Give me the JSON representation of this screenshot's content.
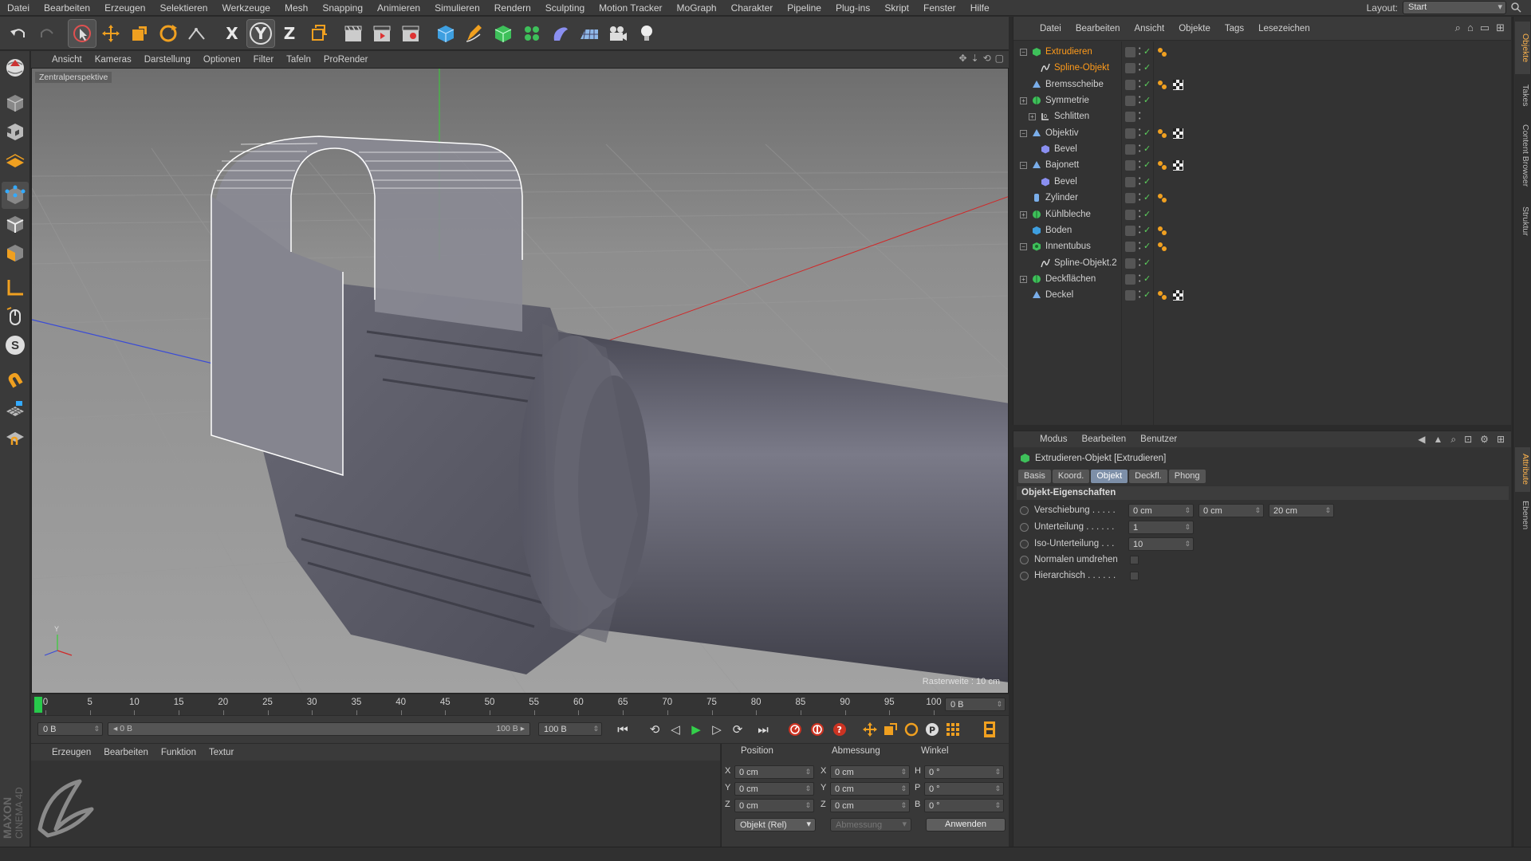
{
  "menubar": {
    "items": [
      "Datei",
      "Bearbeiten",
      "Erzeugen",
      "Selektieren",
      "Werkzeuge",
      "Mesh",
      "Snapping",
      "Animieren",
      "Simulieren",
      "Rendern",
      "Sculpting",
      "Motion Tracker",
      "MoGraph",
      "Charakter",
      "Pipeline",
      "Plug-ins",
      "Skript",
      "Fenster",
      "Hilfe"
    ],
    "layout_label": "Layout:",
    "layout_value": "Start"
  },
  "toolbar": {
    "axis_x": "X",
    "axis_y": "Y",
    "axis_z": "Z"
  },
  "left_palette": {
    "snap_letter": "S"
  },
  "viewport": {
    "menu": [
      "Ansicht",
      "Kameras",
      "Darstellung",
      "Optionen",
      "Filter",
      "Tafeln",
      "ProRender"
    ],
    "label": "Zentralperspektive",
    "raster": "Rasterweite : 10 cm"
  },
  "timeline": {
    "ticks": [
      "0",
      "5",
      "10",
      "15",
      "20",
      "25",
      "30",
      "35",
      "40",
      "45",
      "50",
      "55",
      "60",
      "65",
      "70",
      "75",
      "80",
      "85",
      "90",
      "95",
      "100"
    ],
    "current_frame_field": "0 B",
    "start_field": "0 B",
    "range_start": "0 B",
    "range_end": "100 B",
    "end_field": "100 B"
  },
  "materials": {
    "menu": [
      "Erzeugen",
      "Bearbeiten",
      "Funktion",
      "Textur"
    ]
  },
  "brand": {
    "line1": "MAXON",
    "line2": "CINEMA 4D"
  },
  "coords": {
    "headers": {
      "position": "Position",
      "size": "Abmessung",
      "rotation": "Winkel"
    },
    "rows": [
      {
        "axis": "X",
        "pos": "0 cm",
        "size_axis": "X",
        "size": "0 cm",
        "rot_axis": "H",
        "rot": "0 °"
      },
      {
        "axis": "Y",
        "pos": "0 cm",
        "size_axis": "Y",
        "size": "0 cm",
        "rot_axis": "P",
        "rot": "0 °"
      },
      {
        "axis": "Z",
        "pos": "0 cm",
        "size_axis": "Z",
        "size": "0 cm",
        "rot_axis": "B",
        "rot": "0 °"
      }
    ],
    "mode_dropdown": "Objekt (Rel)",
    "size_dropdown": "Abmessung",
    "apply": "Anwenden"
  },
  "object_manager": {
    "menu": [
      "Datei",
      "Bearbeiten",
      "Ansicht",
      "Objekte",
      "Tags",
      "Lesezeichen"
    ],
    "objects": [
      {
        "name": "Extrudieren",
        "depth": 0,
        "expand": "−",
        "icon": "extrude-icon",
        "selected": true,
        "tags": [
          "phong"
        ]
      },
      {
        "name": "Spline-Objekt",
        "depth": 1,
        "expand": "",
        "icon": "spline-icon",
        "selected": true,
        "tags": []
      },
      {
        "name": "Bremsscheibe",
        "depth": 0,
        "expand": "",
        "icon": "polygon-icon",
        "selected": false,
        "tags": [
          "phong",
          "checker"
        ]
      },
      {
        "name": "Symmetrie",
        "depth": 0,
        "expand": "+",
        "icon": "symmetry-icon",
        "selected": false,
        "tags": []
      },
      {
        "name": "Schlitten",
        "depth": 1,
        "expand": "+",
        "icon": "null-icon",
        "selected": false,
        "tags": []
      },
      {
        "name": "Objektiv",
        "depth": 0,
        "expand": "−",
        "icon": "polygon-icon",
        "selected": false,
        "tags": [
          "phong",
          "checker"
        ]
      },
      {
        "name": "Bevel",
        "depth": 1,
        "expand": "",
        "icon": "bevel-icon",
        "selected": false,
        "tags": []
      },
      {
        "name": "Bajonett",
        "depth": 0,
        "expand": "−",
        "icon": "polygon-icon",
        "selected": false,
        "tags": [
          "phong",
          "checker"
        ]
      },
      {
        "name": "Bevel",
        "depth": 1,
        "expand": "",
        "icon": "bevel-icon",
        "selected": false,
        "tags": []
      },
      {
        "name": "Zylinder",
        "depth": 0,
        "expand": "",
        "icon": "cylinder-icon",
        "selected": false,
        "tags": [
          "phong"
        ]
      },
      {
        "name": "Kühlbleche",
        "depth": 0,
        "expand": "+",
        "icon": "symmetry-icon",
        "selected": false,
        "tags": []
      },
      {
        "name": "Boden",
        "depth": 0,
        "expand": "",
        "icon": "cube-icon",
        "selected": false,
        "tags": [
          "phong"
        ]
      },
      {
        "name": "Innentubus",
        "depth": 0,
        "expand": "−",
        "icon": "lathe-icon",
        "selected": false,
        "tags": [
          "phong"
        ]
      },
      {
        "name": "Spline-Objekt.2",
        "depth": 1,
        "expand": "",
        "icon": "spline-icon",
        "selected": false,
        "tags": []
      },
      {
        "name": "Deckflächen",
        "depth": 0,
        "expand": "+",
        "icon": "symmetry-icon",
        "selected": false,
        "tags": []
      },
      {
        "name": "Deckel",
        "depth": 0,
        "expand": "",
        "icon": "polygon-icon",
        "selected": false,
        "tags": [
          "phong",
          "checker"
        ]
      }
    ]
  },
  "attribute_manager": {
    "menu": [
      "Modus",
      "Bearbeiten",
      "Benutzer"
    ],
    "title": "Extrudieren-Objekt [Extrudieren]",
    "tabs": [
      "Basis",
      "Koord.",
      "Objekt",
      "Deckfl.",
      "Phong"
    ],
    "active_tab": "Objekt",
    "section": "Objekt-Eigenschaften",
    "fields": {
      "offset_label": "Verschiebung . . . . .",
      "offset_x": "0 cm",
      "offset_y": "0 cm",
      "offset_z": "20 cm",
      "subdiv_label": "Unterteilung . . . . . .",
      "subdiv_value": "1",
      "iso_label": "Iso-Unterteilung . . .",
      "iso_value": "10",
      "flip_label": "Normalen umdrehen",
      "hier_label": "Hierarchisch . . . . . ."
    }
  },
  "right_tabs": [
    "Objekte",
    "Takes",
    "Content Browser",
    "Struktur",
    "Attribute",
    "Ebenen"
  ],
  "colors": {
    "accent": "#ff9b1a",
    "active_tab": "#7d8fa8",
    "frame_marker": "#27c94b"
  }
}
